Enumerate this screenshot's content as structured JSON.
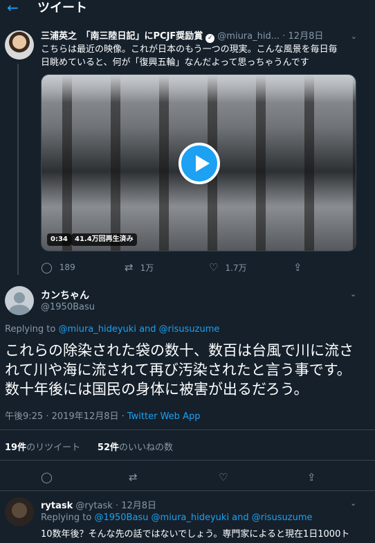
{
  "header": {
    "title": "ツイート"
  },
  "tweet1": {
    "name": "三浦英之　「南三陸日記」にPCJF奨励賞",
    "handle": "@miura_hid...",
    "date": "12月8日",
    "text_line1": "こちらは最近の映像。これが日本のもう一つの現実。こんな風景を毎日毎",
    "text_line2": "日眺めていると、何が「復興五輪」なんだよって思っちゃうんです",
    "video": {
      "duration": "0:34",
      "views": "41.4万回再生済み"
    },
    "replies": "189",
    "retweets": "1万",
    "likes": "1.7万"
  },
  "tweet2": {
    "name": "カンちゃん",
    "handle": "@1950Basu",
    "replying_prefix": "Replying to",
    "replying_to": "@miura_hideyuki and @risusuzume",
    "text_line1": "これらの除染された袋の数十、数百は台風で川に流さ",
    "text_line2": "れて川や海に流されて再び汚染されたと言う事です。",
    "text_line3": "数十年後には国民の身体に被害が出るだろう。",
    "time": "午後9:25 · 2019年12月8日 · ",
    "app": "Twitter Web App",
    "retweet_count": "19件",
    "retweet_label": "のリツイート",
    "like_count": "52件",
    "like_label": "のいいねの数"
  },
  "tweet3": {
    "name": "rytask",
    "handle": "@rytask",
    "date": "12月8日",
    "replying_prefix": "Replying to",
    "replying_to": "@1950Basu @miura_hideyuki and @risusuzume",
    "text": "10数年後？そんな先の話ではないでしょう。専門家によると現在1日1000ト"
  },
  "icons": [
    "back-arrow-icon",
    "verified-icon",
    "chevron-down-icon",
    "reply-icon",
    "retweet-icon",
    "like-icon",
    "share-icon",
    "play-icon"
  ],
  "colors": {
    "background": "#15202b",
    "accent": "#1da1f2",
    "muted": "#8899a6",
    "divider": "#38444d"
  }
}
